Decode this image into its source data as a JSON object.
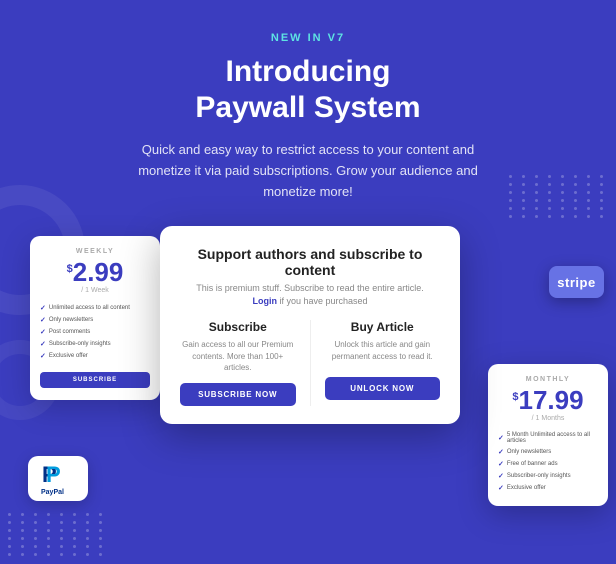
{
  "badge": "NEW IN V7",
  "title": "Introducing\nPaywall System",
  "subtitle": "Quick and easy way to restrict access to your content and monetize it via paid subscriptions. Grow your audience and monetize more!",
  "weekly_card": {
    "label": "WEEKLY",
    "currency": "$",
    "price": "2.99",
    "period": "/ 1 Week",
    "features": [
      "Unlimited access to all content",
      "Only newsletters",
      "Post comments",
      "Subscribe-only insights",
      "Exclusive offer"
    ],
    "button": "SUBSCRIBE"
  },
  "modal": {
    "title": "Support authors and subscribe to content",
    "desc": "This is premium stuff. Subscribe to read the entire article.",
    "login_text": "Login if you have purchased",
    "subscribe": {
      "title": "Subscribe",
      "desc": "Gain access to all our Premium contents. More than 100+ articles.",
      "button": "SUBSCRIBE NOW"
    },
    "buy_article": {
      "title": "Buy Article",
      "desc": "Unlock this article and gain permanent access to read it.",
      "button": "UNLOCK NOW"
    }
  },
  "stripe": {
    "text": "stripe"
  },
  "monthly_card": {
    "label": "MONTHLY",
    "currency": "$",
    "price": "17.99",
    "period": "/ 1 Months",
    "features": [
      "5 Month Unlimited access to all articles",
      "Only newsletters",
      "Free of banner ads",
      "Subscriber-only insights",
      "Exclusive offer"
    ]
  },
  "paypal": {
    "text": "PayPal"
  }
}
